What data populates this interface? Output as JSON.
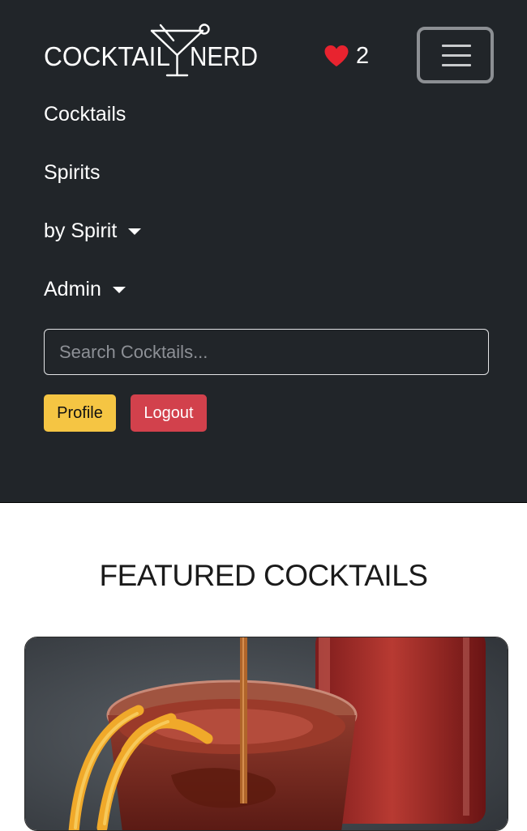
{
  "brand": {
    "name_left": "COCKTAIL",
    "name_right": "NERD"
  },
  "favorites": {
    "count": "2",
    "heart_color": "#e8232f"
  },
  "nav": {
    "items": [
      {
        "label": "Cocktails"
      },
      {
        "label": "Spirits"
      },
      {
        "label": "by Spirit"
      },
      {
        "label": "Admin"
      }
    ]
  },
  "search": {
    "placeholder": "Search Cocktails..."
  },
  "buttons": {
    "profile": "Profile",
    "logout": "Logout"
  },
  "colors": {
    "navbar_bg": "#212529",
    "profile_bg": "#f5c543",
    "logout_bg": "#d2414c"
  },
  "featured": {
    "title": "FEATURED COCKTAILS"
  }
}
